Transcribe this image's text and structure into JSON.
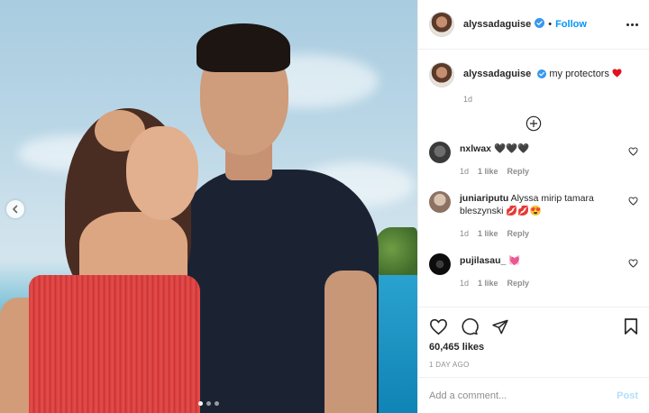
{
  "post_header": {
    "username": "alyssadaguise",
    "separator": "•",
    "follow_label": "Follow"
  },
  "caption": {
    "username": "alyssadaguise",
    "text": "my protectors",
    "time": "1d"
  },
  "comments": [
    {
      "username": "nxlwax",
      "text": "🖤🖤🖤",
      "time": "1d",
      "likes": "1 like",
      "reply": "Reply",
      "avatar_color": "#4a4a4a"
    },
    {
      "username": "juniariputu",
      "text": "Alyssa mirip tamara bleszynski 💋💋😍",
      "time": "1d",
      "likes": "1 like",
      "reply": "Reply",
      "avatar_color": "#bda89a"
    },
    {
      "username": "pujilasau_",
      "text": "💓",
      "time": "1d",
      "likes": "1 like",
      "reply": "Reply",
      "avatar_color": "#1a1a1a"
    }
  ],
  "actions": {
    "likes": "60,465 likes",
    "posted": "1 DAY AGO"
  },
  "add_comment": {
    "placeholder": "Add a comment...",
    "post_label": "Post"
  },
  "carousel": {
    "pages": 3,
    "active": 1
  },
  "colors": {
    "accent": "#0095f6",
    "heart": "#ed4956",
    "muted": "#8e8e8e"
  }
}
